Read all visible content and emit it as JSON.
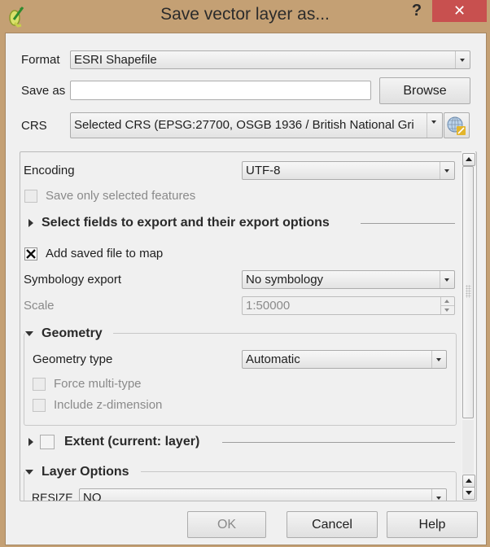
{
  "window": {
    "title": "Save vector layer as...",
    "help_label": "?",
    "close_label": "✕"
  },
  "form": {
    "format_label": "Format",
    "format_value": "ESRI Shapefile",
    "save_as_label": "Save as",
    "save_as_value": "",
    "browse_label": "Browse",
    "crs_label": "CRS",
    "crs_value": "Selected CRS (EPSG:27700, OSGB 1936 / British National Gri"
  },
  "options": {
    "encoding_label": "Encoding",
    "encoding_value": "UTF-8",
    "save_selected_label": "Save only selected features",
    "save_selected_checked": false,
    "select_fields_label": "Select fields to export and their export options",
    "add_to_map_label": "Add saved file to map",
    "add_to_map_checked": true,
    "add_to_map_mark": "✕",
    "symbology_label": "Symbology export",
    "symbology_value": "No symbology",
    "scale_label": "Scale",
    "scale_value": "1:50000",
    "geometry": {
      "title": "Geometry",
      "type_label": "Geometry type",
      "type_value": "Automatic",
      "force_multi_label": "Force multi-type",
      "include_z_label": "Include z-dimension"
    },
    "extent_label": "Extent (current: layer)",
    "layer_options": {
      "title": "Layer Options",
      "resize_label": "RESIZE",
      "resize_value": "NO"
    }
  },
  "buttons": {
    "ok": "OK",
    "cancel": "Cancel",
    "help": "Help"
  }
}
